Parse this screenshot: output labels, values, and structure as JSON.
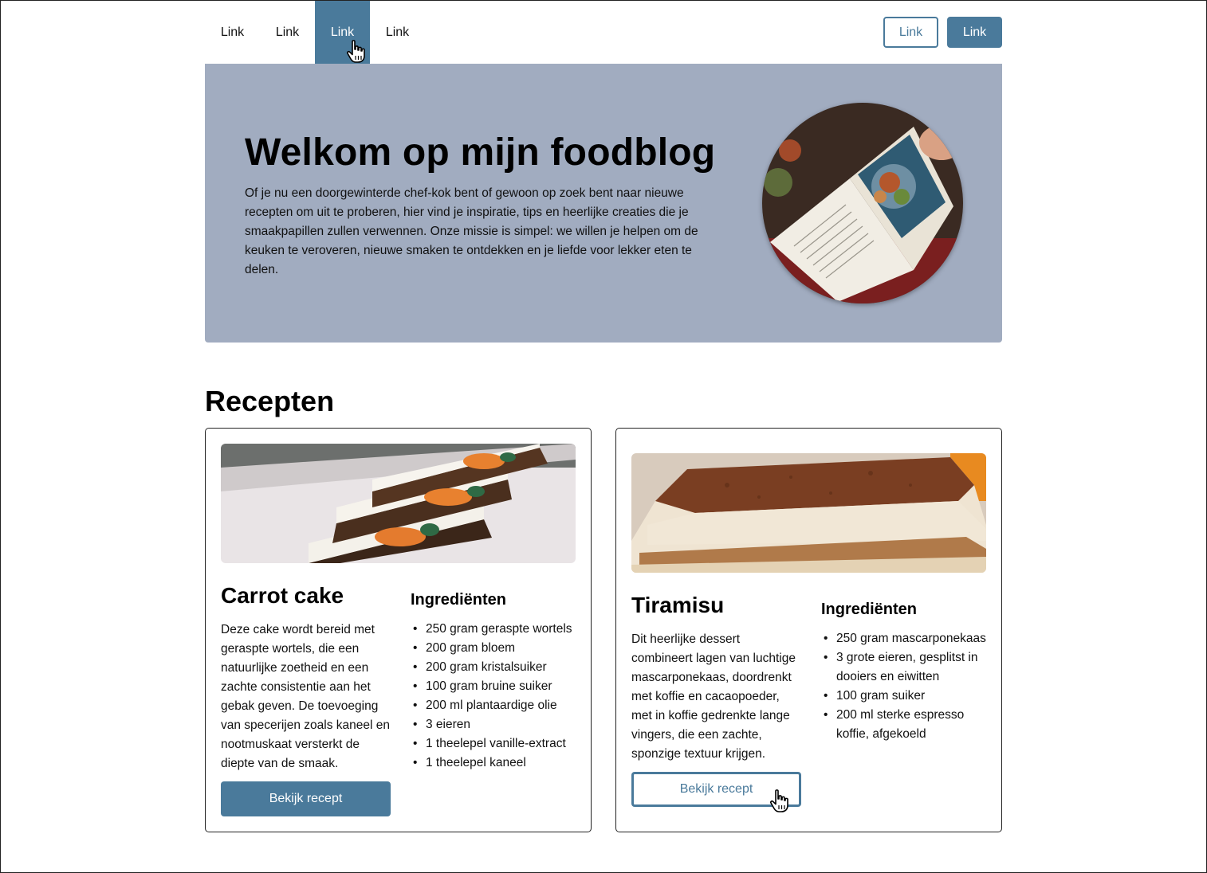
{
  "nav": {
    "links": [
      "Link",
      "Link",
      "Link",
      "Link"
    ],
    "active_index": 2,
    "outline_button": "Link",
    "solid_button": "Link"
  },
  "hero": {
    "title": "Welkom op mijn foodblog",
    "text": "Of je nu een doorgewinterde chef-kok bent of gewoon op zoek bent naar nieuwe recepten om uit te proberen, hier vind je inspiratie, tips en heerlijke creaties die je smaakpapillen zullen verwennen. Onze missie is simpel: we willen je helpen om de keuken te veroveren, nieuwe smaken te ontdekken en je liefde voor lekker eten te delen."
  },
  "recipes": {
    "title": "Recepten",
    "cards": [
      {
        "title": "Carrot cake",
        "description": "Deze cake wordt bereid met geraspte wortels, die een natuurlijke zoetheid en een zachte consistentie aan het gebak geven. De toevoeging van specerijen zoals kaneel en nootmuskaat versterkt de diepte van de smaak.",
        "ingredients_title": "Ingrediënten",
        "ingredients": [
          "250 gram geraspte wortels",
          "200 gram bloem",
          "200 gram kristalsuiker",
          "100 gram bruine suiker",
          "200 ml plantaardige olie",
          "3 eieren",
          "1 theelepel vanille-extract",
          "1 theelepel kaneel"
        ],
        "button": "Bekijk recept"
      },
      {
        "title": "Tiramisu",
        "description": "Dit heerlijke dessert combineert lagen van luchtige mascarponekaas, doordrenkt met koffie en cacaopoeder, met in koffie gedrenkte lange vingers, die een zachte, sponzige textuur krijgen.",
        "ingredients_title": "Ingrediënten",
        "ingredients": [
          "250 gram mascarponekaas",
          "3 grote eieren, gesplitst in dooiers en eiwitten",
          "100 gram suiker",
          "200 ml sterke espresso koffie, afgekoeld"
        ],
        "button": "Bekijk recept"
      }
    ]
  },
  "colors": {
    "accent": "#4a7a9b",
    "hero_bg": "#a1acc0"
  },
  "icons": [
    "hand-pointer-cursor-icon"
  ]
}
